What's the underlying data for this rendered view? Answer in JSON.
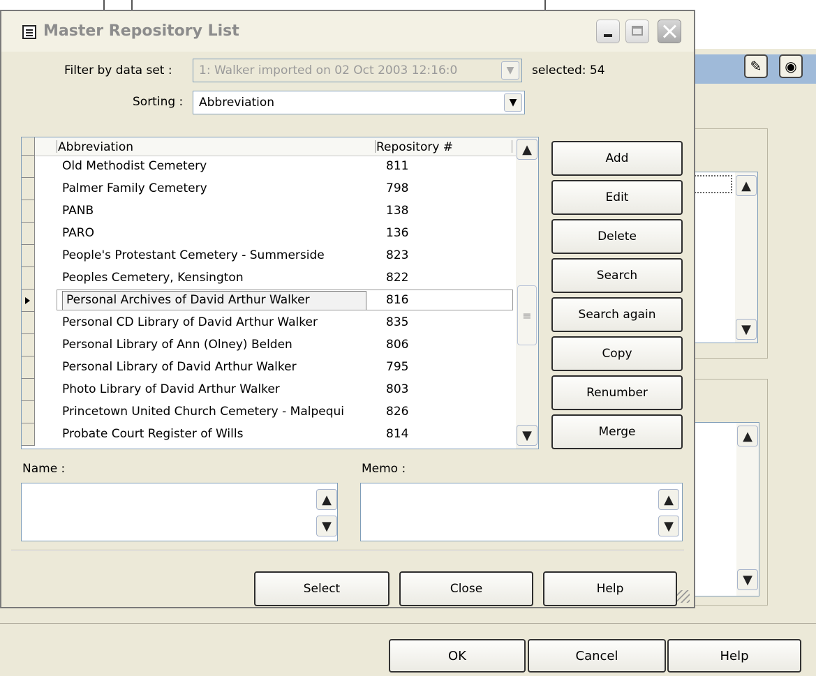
{
  "dialog": {
    "title": "Master Repository List",
    "filter_label": "Filter by data set :",
    "filter_value": "1:  Walker imported on 02 Oct 2003 12:16:0",
    "selected_text": "selected: 54",
    "sorting_label": "Sorting :",
    "sorting_value": "Abbreviation"
  },
  "grid": {
    "columns": [
      "Abbreviation",
      "Repository #"
    ],
    "rows": [
      {
        "abbreviation": "Old Methodist Cemetery",
        "number": "811"
      },
      {
        "abbreviation": "Palmer Family Cemetery",
        "number": "798"
      },
      {
        "abbreviation": "PANB",
        "number": "138"
      },
      {
        "abbreviation": "PARO",
        "number": "136"
      },
      {
        "abbreviation": "People's Protestant Cemetery - Summerside",
        "number": "823"
      },
      {
        "abbreviation": "Peoples Cemetery, Kensington",
        "number": "822"
      },
      {
        "abbreviation": "Personal Archives of David Arthur Walker",
        "number": "816"
      },
      {
        "abbreviation": "Personal CD Library of David Arthur Walker",
        "number": "835"
      },
      {
        "abbreviation": "Personal Library of Ann (Olney) Belden",
        "number": "806"
      },
      {
        "abbreviation": "Personal Library of David Arthur Walker",
        "number": "795"
      },
      {
        "abbreviation": "Photo Library of David Arthur Walker",
        "number": "803"
      },
      {
        "abbreviation": "Princetown United Church Cemetery - Malpequi",
        "number": "826"
      },
      {
        "abbreviation": "Probate Court Register of Wills",
        "number": "814"
      }
    ],
    "current_row_index": 6
  },
  "actions": [
    "Add",
    "Edit",
    "Delete",
    "Search",
    "Search again",
    "Copy",
    "Renumber",
    "Merge"
  ],
  "fields": {
    "name_label": "Name :",
    "name_value": "",
    "memo_label": "Memo :",
    "memo_value": ""
  },
  "footer": {
    "select": "Select",
    "close": "Close",
    "help": "Help"
  },
  "background_window": {
    "ok": "OK",
    "cancel": "Cancel",
    "help": "Help"
  },
  "icons": {
    "up": "▲",
    "down": "▼",
    "grip": "≡"
  }
}
